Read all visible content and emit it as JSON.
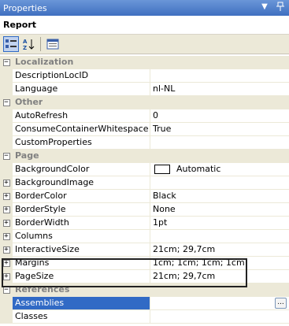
{
  "window": {
    "title": "Properties",
    "dropdown_glyph": "▼",
    "pin_glyph": "📌",
    "object_name": "Report"
  },
  "toolbar": {
    "buttons": [
      {
        "icon": "categorized-icon",
        "active": true
      },
      {
        "icon": "alphabetical-sort-icon",
        "active": false
      },
      {
        "icon": "property-pages-icon",
        "active": false
      }
    ]
  },
  "grid": {
    "rows": [
      {
        "type": "category",
        "expanded": true,
        "label": "Localization"
      },
      {
        "type": "prop",
        "name": "DescriptionLocID",
        "value": ""
      },
      {
        "type": "prop",
        "name": "Language",
        "value": "nl-NL"
      },
      {
        "type": "category",
        "expanded": true,
        "label": "Other"
      },
      {
        "type": "prop",
        "name": "AutoRefresh",
        "value": "0"
      },
      {
        "type": "prop",
        "name": "ConsumeContainerWhitespace",
        "value": "True"
      },
      {
        "type": "prop",
        "name": "CustomProperties",
        "value": ""
      },
      {
        "type": "category",
        "expanded": true,
        "label": "Page"
      },
      {
        "type": "prop",
        "name": "BackgroundColor",
        "value": "Automatic",
        "swatch": "#ffffff"
      },
      {
        "type": "prop",
        "name": "BackgroundImage",
        "value": "",
        "expandable": true
      },
      {
        "type": "prop",
        "name": "BorderColor",
        "value": "Black",
        "expandable": true
      },
      {
        "type": "prop",
        "name": "BorderStyle",
        "value": "None",
        "expandable": true
      },
      {
        "type": "prop",
        "name": "BorderWidth",
        "value": "1pt",
        "expandable": true
      },
      {
        "type": "prop",
        "name": "Columns",
        "value": "",
        "expandable": true
      },
      {
        "type": "prop",
        "name": "InteractiveSize",
        "value": "21cm; 29,7cm",
        "expandable": true
      },
      {
        "type": "prop",
        "name": "Margins",
        "value": "1cm; 1cm; 1cm; 1cm",
        "expandable": true
      },
      {
        "type": "prop",
        "name": "PageSize",
        "value": "21cm; 29,7cm",
        "expandable": true
      },
      {
        "type": "category",
        "expanded": true,
        "label": "References"
      },
      {
        "type": "prop",
        "name": "Assemblies",
        "value": "",
        "selected": true,
        "button": "..."
      },
      {
        "type": "prop",
        "name": "Classes",
        "value": ""
      }
    ]
  },
  "colors": {
    "titlebar": "#3f6fc0",
    "selection": "#316ac5",
    "category_bg": "#ece9d8"
  }
}
